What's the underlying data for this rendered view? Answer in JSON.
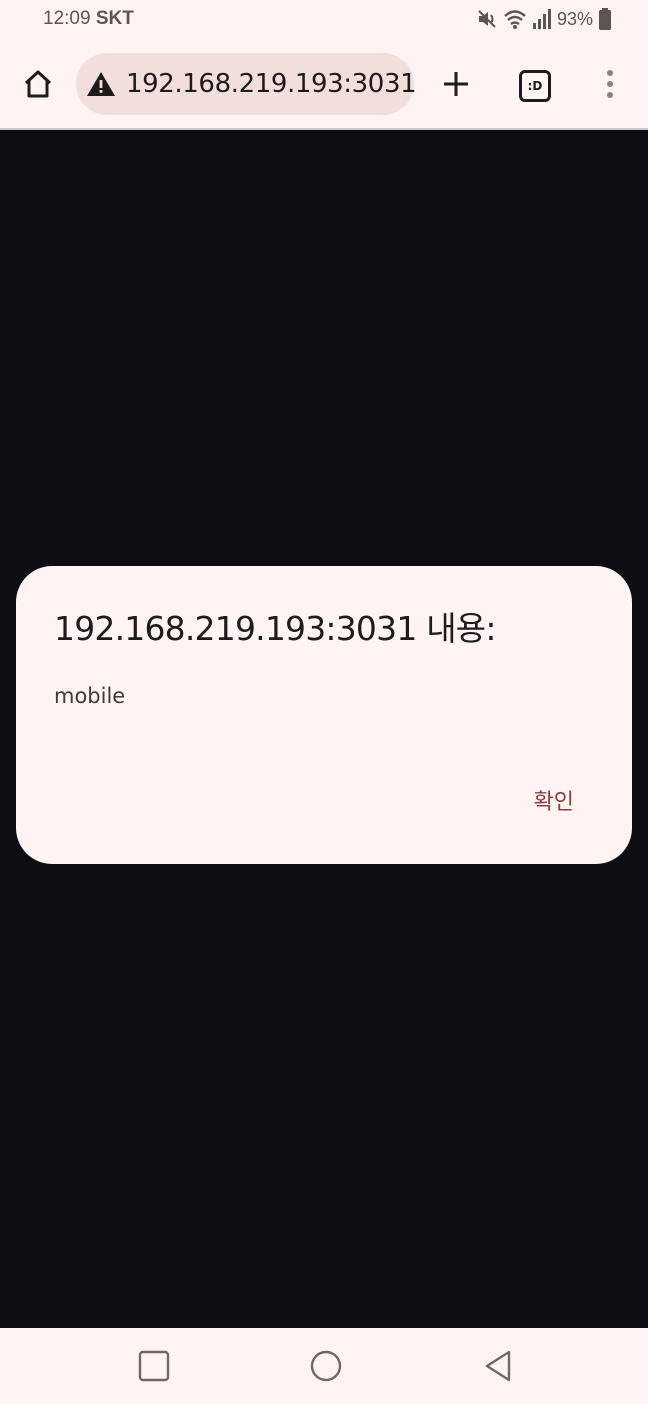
{
  "status_bar": {
    "time": "12:09",
    "carrier": "SKT",
    "battery": "93%",
    "icons": [
      "mute-icon",
      "wifi-icon",
      "signal-icon",
      "battery-icon"
    ]
  },
  "browser": {
    "url": "192.168.219.193:3031",
    "tabs_label": ":D",
    "icons": [
      "home-icon",
      "warning-icon",
      "plus-icon",
      "tabs-icon",
      "more-vert-icon"
    ]
  },
  "dialog": {
    "title": "192.168.219.193:3031 내용:",
    "message": "mobile",
    "confirm_label": "확인"
  },
  "nav_bar": {
    "icons": [
      "recents-icon",
      "home-circle-icon",
      "back-icon"
    ]
  },
  "colors": {
    "surface": "#fff4f1",
    "page_background": "#0e0d13",
    "omnibox": "#f2dedb",
    "accent": "#8d3f3c",
    "text_primary": "#1e1b1c"
  }
}
